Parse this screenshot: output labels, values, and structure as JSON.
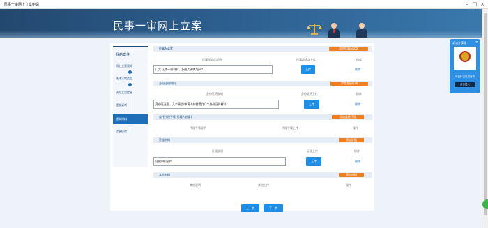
{
  "window": {
    "title": "民事一审网上立案申请"
  },
  "banner": {
    "title": "民事一审网上立案"
  },
  "sidebar": {
    "title": "我的案件",
    "items": [
      {
        "label": "网上立案须知"
      },
      {
        "label": "选择法院类型"
      },
      {
        "label": "填写立案信息"
      },
      {
        "label": "提交诉状"
      },
      {
        "label": "提交材料"
      },
      {
        "label": "信息核验"
      }
    ]
  },
  "sections": {
    "evidence": {
      "title": "民事起诉状",
      "add_label": "添加民事起诉状",
      "col_desc": "民事起诉状说明",
      "col_upload": "民事起诉状上传",
      "col_op": "操作",
      "value": "门文 上传一份材料，多图片请转为pdf",
      "upload_label": "上传",
      "delete_label": "删除"
    },
    "identity": {
      "title": "身份证明材料",
      "add_label": "添加身份证明",
      "col_desc": "身份证明说明",
      "col_upload": "身份证明上传",
      "col_op": "操作",
      "value": "身份证正面，几个原告/申请人共需提交几个身份证明材料",
      "upload_label": "上传",
      "delete_label": "删除"
    },
    "agent": {
      "title": "委托代理手续(代理人必填)",
      "add_label": "添加委托代理",
      "col_desc": "代理手续说明",
      "col_upload": "代理手续上传",
      "col_op": "操作"
    },
    "proof": {
      "title": "证据材料",
      "add_label": "添加证据",
      "col_desc": "证据说明",
      "col_upload": "证据上传",
      "col_op": "操作",
      "value": "证据材料必传",
      "upload_label": "上传",
      "delete_label": "删除"
    },
    "other": {
      "title": "其他材料",
      "add_label": "添加材料",
      "col_desc": "其他说明",
      "col_upload": "其他上传",
      "col_op": "操作"
    }
  },
  "footer": {
    "prev_label": "上一步",
    "next_label": "下一步"
  },
  "widget": {
    "title": "诉讼计算器",
    "close": "×",
    "subtitle": "可自行诉讼费计算",
    "open_label": "点击进入"
  },
  "colors": {
    "accent": "#1e8ee6",
    "orange": "#ee7f22",
    "navy": "#1e4f80"
  }
}
